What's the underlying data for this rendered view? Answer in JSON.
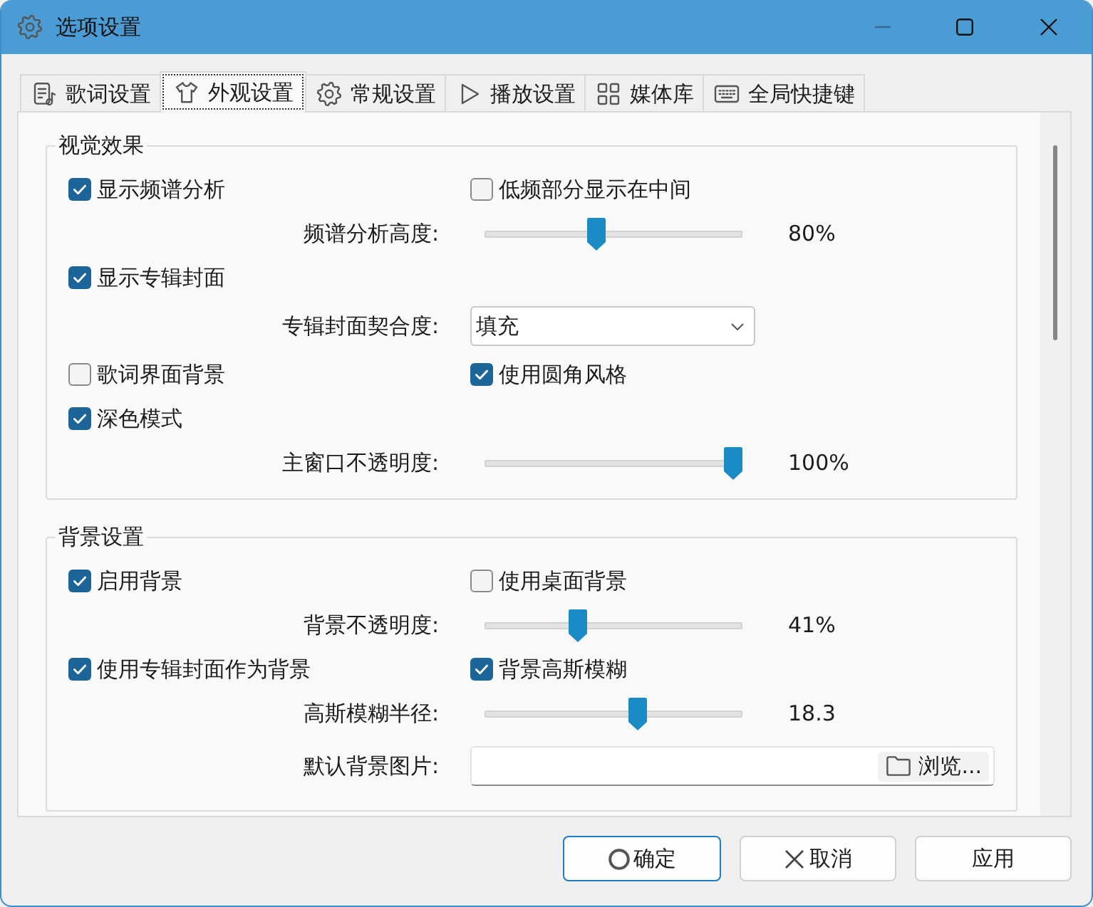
{
  "window": {
    "title": "选项设置",
    "minimize_disabled": true
  },
  "tabs": [
    {
      "kind": "lyrics",
      "label": "歌词设置",
      "selected": false
    },
    {
      "kind": "appearance",
      "label": "外观设置",
      "selected": true
    },
    {
      "kind": "general",
      "label": "常规设置",
      "selected": false
    },
    {
      "kind": "playback",
      "label": "播放设置",
      "selected": false
    },
    {
      "kind": "library",
      "label": "媒体库",
      "selected": false
    },
    {
      "kind": "hotkeys",
      "label": "全局快捷键",
      "selected": false
    }
  ],
  "groups": [
    {
      "title": "视觉效果",
      "rows": [
        {
          "kind": "checks",
          "items": [
            {
              "label": "显示频谱分析",
              "checked": true
            },
            {
              "label": "低频部分显示在中间",
              "checked": false
            }
          ]
        },
        {
          "kind": "slider",
          "label": "频谱分析高度:",
          "level": 0.43,
          "reading": "80%"
        },
        {
          "kind": "checks",
          "items": [
            {
              "label": "显示专辑封面",
              "checked": true
            }
          ]
        },
        {
          "kind": "dropdown",
          "label": "专辑封面契合度:",
          "value": "填充"
        },
        {
          "kind": "checks",
          "items": [
            {
              "label": "歌词界面背景",
              "checked": false
            },
            {
              "label": "使用圆角风格",
              "checked": true
            }
          ]
        },
        {
          "kind": "checks",
          "items": [
            {
              "label": "深色模式",
              "checked": true
            }
          ]
        },
        {
          "kind": "slider",
          "label": "主窗口不透明度:",
          "level": 1,
          "reading": "100%"
        }
      ]
    },
    {
      "title": "背景设置",
      "rows": [
        {
          "kind": "checks",
          "items": [
            {
              "label": "启用背景",
              "checked": true
            },
            {
              "label": "使用桌面背景",
              "checked": false
            }
          ]
        },
        {
          "kind": "slider",
          "label": "背景不透明度:",
          "level": 0.35,
          "reading": "41%"
        },
        {
          "kind": "checks",
          "items": [
            {
              "label": "使用专辑封面作为背景",
              "checked": true
            },
            {
              "label": "背景高斯模糊",
              "checked": true
            }
          ]
        },
        {
          "kind": "slider",
          "label": "高斯模糊半径:",
          "level": 0.6,
          "reading": "18.3"
        },
        {
          "kind": "file",
          "label": "默认背景图片:",
          "button": "浏览..."
        }
      ]
    }
  ],
  "buttons": [
    {
      "kind": "ok",
      "label": "确定",
      "default": true
    },
    {
      "kind": "cancel",
      "label": "取消",
      "default": false
    },
    {
      "kind": "apply",
      "label": "应用",
      "default": false
    }
  ]
}
